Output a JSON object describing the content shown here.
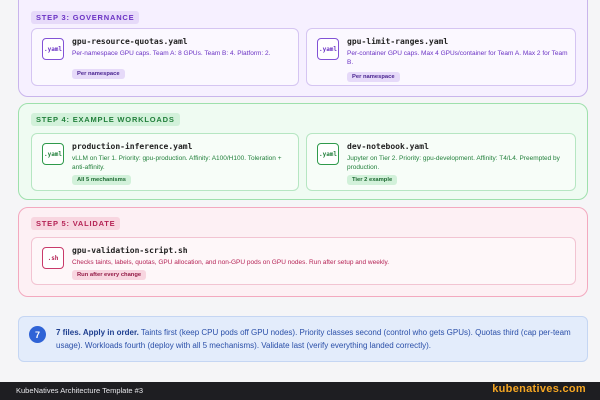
{
  "steps": {
    "s3": {
      "label": "STEP 3: GOVERNANCE",
      "cards": [
        {
          "icon": ".yaml",
          "name": "gpu-resource-quotas.yaml",
          "desc": "Per-namespace GPU caps. Team A: 8 GPUs. Team B: 4. Platform: 2.",
          "tag": "Per namespace"
        },
        {
          "icon": ".yaml",
          "name": "gpu-limit-ranges.yaml",
          "desc": "Per-container GPU caps. Max 4 GPUs/container for Team A. Max 2 for Team B.",
          "tag": "Per namespace"
        }
      ]
    },
    "s4": {
      "label": "STEP 4: EXAMPLE WORKLOADS",
      "cards": [
        {
          "icon": ".yaml",
          "name": "production-inference.yaml",
          "desc": "vLLM on Tier 1. Priority: gpu-production. Affinity: A100/H100. Toleration + anti-affinity.",
          "tag": "All 5 mechanisms"
        },
        {
          "icon": ".yaml",
          "name": "dev-notebook.yaml",
          "desc": "Jupyter on Tier 2. Priority: gpu-development. Affinity: T4/L4. Preempted by production.",
          "tag": "Tier 2 example"
        }
      ]
    },
    "s5": {
      "label": "STEP 5: VALIDATE",
      "cards": [
        {
          "icon": ".sh",
          "name": "gpu-validation-script.sh",
          "desc": "Checks taints, labels, quotas, GPU allocation, and non-GPU pods on GPU nodes. Run after setup and weekly.",
          "tag": "Run after every change"
        }
      ]
    }
  },
  "summary": {
    "badge": "7",
    "lead": "7 files. Apply in order.",
    "body": " Taints first (keep CPU pods off GPU nodes). Priority classes second (control who gets GPUs). Quotas third (cap per-team usage). Workloads fourth (deploy with all 5 mechanisms). Validate last (verify everything landed correctly)."
  },
  "footer": {
    "left": "KubeNatives Architecture Template #3",
    "right": "kubenatives.com"
  },
  "colors": {
    "step3_accent": "#6b33c4",
    "step4_accent": "#23803c",
    "step5_accent": "#b52456",
    "summary_accent": "#2f63d6",
    "footer_brand": "#f5a623"
  }
}
